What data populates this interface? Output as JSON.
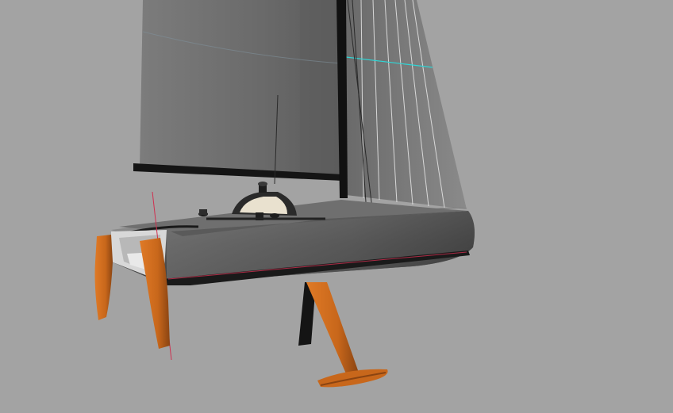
{
  "scene": {
    "subject": "sailboat-3d-render",
    "background_color": "#a3a3a3",
    "colors": {
      "sail": "#6b6b6b",
      "sail_light": "#8a8a8a",
      "hull": "#555555",
      "deck": "#7a7a7a",
      "appendage": "#c8671b",
      "appendage_dark": "#8a4412",
      "mast": "#111111",
      "rigging_accent": "#2fd6d6",
      "guide_line": "#d03050"
    }
  }
}
